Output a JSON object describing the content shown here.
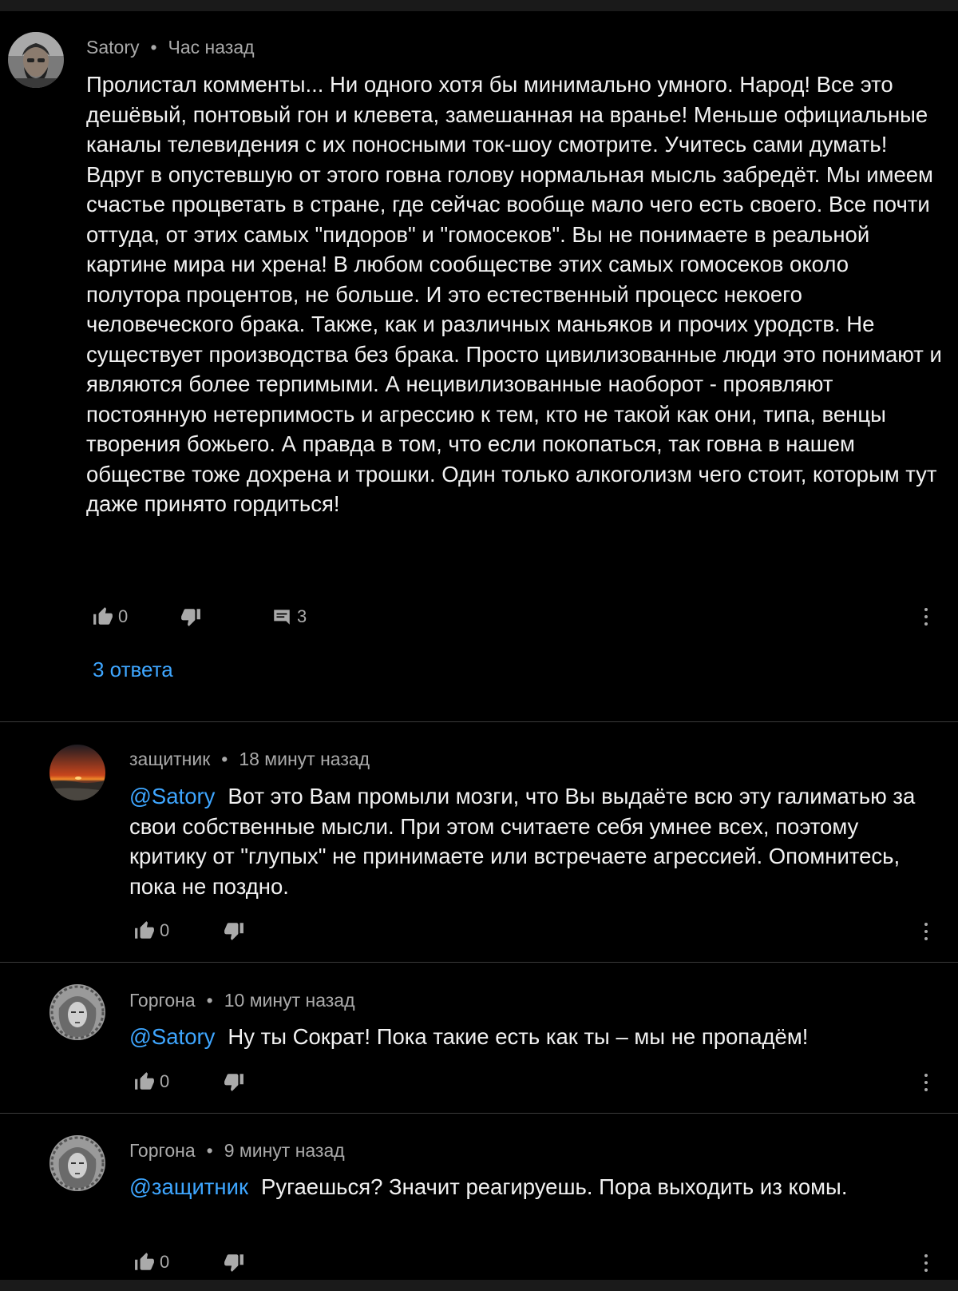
{
  "main_comment": {
    "author": "Satory",
    "separator": "•",
    "time": "Час назад",
    "text": "Пролистал комменты... Ни одного хотя бы минимально умного. Народ! Все это дешёвый, понтовый гон и клевета, замешанная на вранье! Меньше официальные каналы телевидения с их поносными ток-шоу смотрите. Учитесь сами думать! Вдруг в опустевшую от этого говна голову нормальная мысль забредёт. Мы имеем счастье процветать в стране, где сейчас вообще мало чего есть своего. Все почти оттуда, от этих самых \"пидоров\" и \"гомосеков\". Вы не понимаете в реальной картине мира ни хрена! В любом сообществе этих самых гомосеков около полутора процентов, не больше. И это естественный процесс некоего человеческого брака. Также, как и различных маньяков и прочих уродств. Не существует производства без брака. Просто цивилизованные люди это понимают и являются более терпимыми. А нецивилизованные наоборот - проявляют постоянную нетерпимость и агрессию к тем, кто не такой как они, типа, венцы творения божьего. А правда в том, что если покопаться, так говна в нашем обществе тоже дохрена и трошки. Один только алкоголизм чего стоит, которым тут даже принято гордиться!",
    "likes": "0",
    "replies_count": "3",
    "replies_link": "3 ответа"
  },
  "replies": [
    {
      "author": "защитник",
      "separator": "•",
      "time": "18 минут назад",
      "mention": "@Satory",
      "text": "Вот это Вам промыли мозги, что Вы выдаёте всю эту галиматью за свои собственные мысли. При этом считаете себя умнее всех, поэтому критику от \"глупых\" не принимаете или встречаете агрессией. Опомнитесь, пока не поздно.",
      "likes": "0"
    },
    {
      "author": "Горгона",
      "separator": "•",
      "time": "10 минут назад",
      "mention": "@Satory",
      "text": "Ну ты Сократ! Пока такие есть как ты – мы не пропадём!",
      "likes": "0"
    },
    {
      "author": "Горгона",
      "separator": "•",
      "time": "9 минут назад",
      "mention": "@защитник",
      "text": "Ругаешься? Значит реагируешь. Пора выходить из комы.",
      "likes": "0"
    }
  ],
  "icons": {
    "like": "thumbs-up-icon",
    "dislike": "thumbs-down-icon",
    "reply": "comment-icon",
    "more": "more-vertical-icon"
  },
  "colors": {
    "background": "#000000",
    "text": "#f1f1f1",
    "meta": "#aaaaaa",
    "link": "#3ea6ff"
  }
}
